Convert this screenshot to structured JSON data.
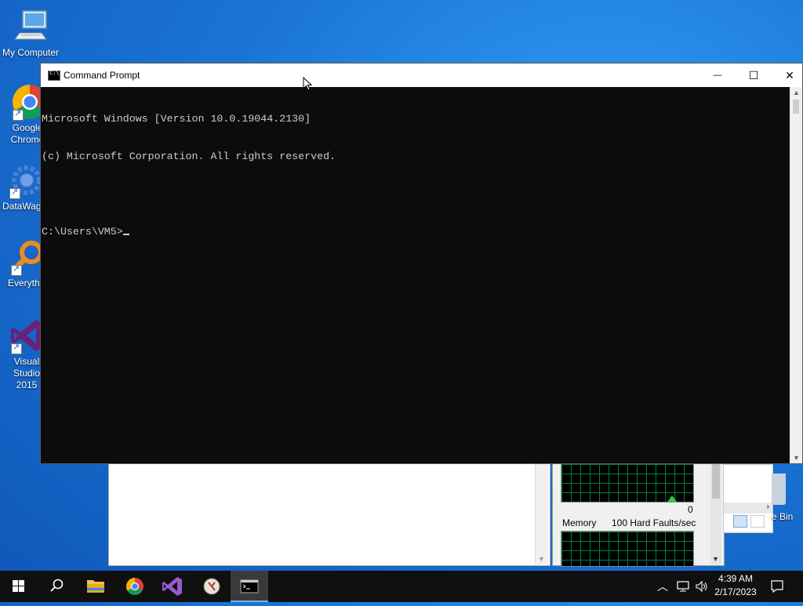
{
  "desktop": {
    "icons": [
      {
        "label": "My Computer"
      },
      {
        "label": "Google Chrome"
      },
      {
        "label": "DataWagon"
      },
      {
        "label": "Everything"
      },
      {
        "label": "Visual Studio 2015"
      }
    ],
    "recycle_partial_label": "e Bin"
  },
  "background_window": {
    "perf_label_memory": "Memory",
    "perf_label_faults": "100 Hard Faults/sec",
    "perf_zero": "0"
  },
  "cmd_window": {
    "title": "Command Prompt",
    "minimize_glyph": "—",
    "maximize_glyph": "☐",
    "close_glyph": "✕",
    "console_lines": [
      "Microsoft Windows [Version 10.0.19044.2130]",
      "(c) Microsoft Corporation. All rights reserved.",
      "",
      "C:\\Users\\VM5>"
    ]
  },
  "taskbar": {
    "items": [
      "start",
      "search",
      "file-explorer",
      "google-chrome",
      "visual-studio",
      "network-tool",
      "command-prompt"
    ],
    "active_item": "command-prompt",
    "tray": {
      "time": "4:39 AM",
      "date": "2/17/2023"
    }
  },
  "colors": {
    "console_bg": "#0c0c0c",
    "console_fg": "#cccccc",
    "taskbar_bg": "#101010",
    "desktop_blue": "#1a74d6"
  }
}
